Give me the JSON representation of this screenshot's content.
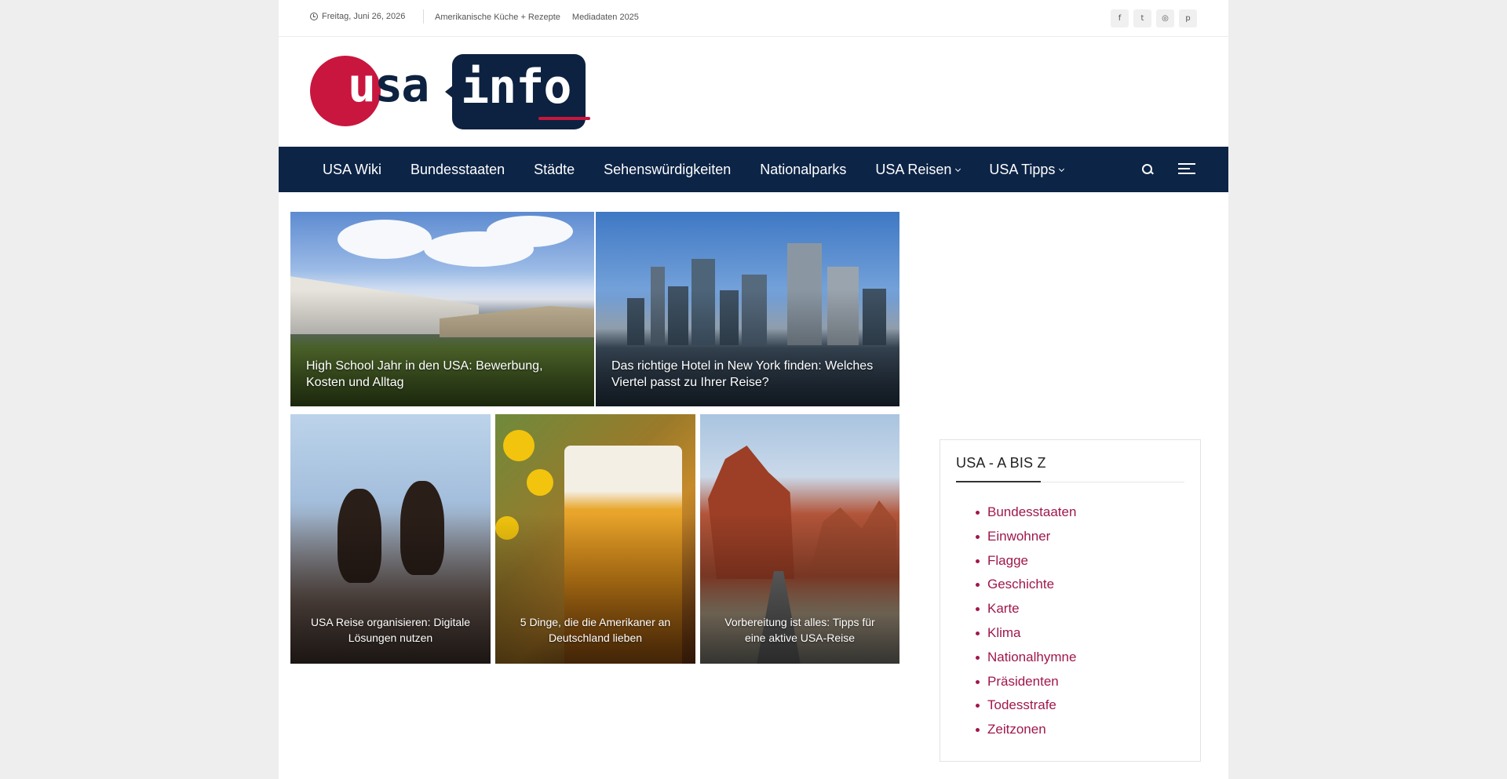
{
  "topbar": {
    "date": "Freitag, Juni 26, 2026",
    "links": [
      "Amerikanische Küche + Rezepte",
      "Mediadaten 2025"
    ],
    "social": [
      {
        "icon": "facebook-icon",
        "glyph": "f"
      },
      {
        "icon": "twitter-icon",
        "glyph": "t"
      },
      {
        "icon": "instagram-icon",
        "glyph": "◎"
      },
      {
        "icon": "pinterest-icon",
        "glyph": "p"
      }
    ]
  },
  "logo": {
    "part1": "usa",
    "part2": "info",
    "colors": {
      "red": "#c8163f",
      "navy": "#0d2240"
    }
  },
  "nav": {
    "items": [
      "USA Wiki",
      "Bundesstaaten",
      "Städte",
      "Sehenswürdigkeiten",
      "Nationalparks",
      "USA Reisen",
      "USA Tipps"
    ],
    "dropdown_items": [
      "USA Reisen",
      "USA Tipps"
    ],
    "background": "#0c2446"
  },
  "tiles": [
    {
      "title": "High School Jahr in den USA: Bewerbung, Kosten und Alltag"
    },
    {
      "title": "Das richtige Hotel in New York finden: Welches Viertel passt zu Ihrer Reise?"
    },
    {
      "title": "USA Reise organisieren: Digitale Lösungen nutzen"
    },
    {
      "title": "5 Dinge, die die Amerikaner an Deutschland lieben"
    },
    {
      "title": "Vorbereitung ist alles: Tipps für eine aktive USA-Reise"
    }
  ],
  "widget": {
    "title": "USA - A BIS Z",
    "items": [
      "Bundesstaaten",
      "Einwohner",
      "Flagge",
      "Geschichte",
      "Karte",
      "Klima",
      "Nationalhymne",
      "Präsidenten",
      "Todesstrafe",
      "Zeitzonen"
    ],
    "link_color": "#a0174b"
  }
}
